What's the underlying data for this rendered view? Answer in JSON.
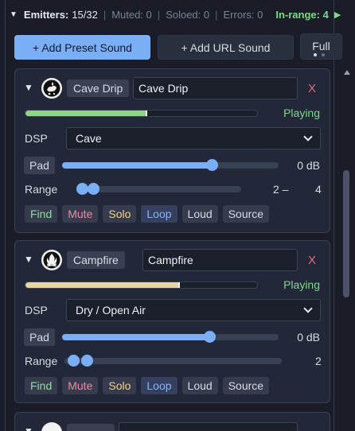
{
  "header": {
    "title": "Emitters:",
    "count": "15/32",
    "muted": "Muted: 0",
    "soloed": "Soloed: 0",
    "errors": "Errors: 0",
    "in_range": "In-range: 4"
  },
  "toolbar": {
    "add_preset": "+ Add Preset Sound",
    "add_url": "+ Add URL Sound",
    "full": "Full"
  },
  "emitters": [
    {
      "tag": "Cave Drip",
      "name": "Cave Drip",
      "progress": 0.52,
      "progress_color": "#8fd48a",
      "status": "Playing",
      "dsp_label": "DSP",
      "dsp": "Cave",
      "pad_label": "Pad",
      "gain_pct": 0.69,
      "gain": "0 dB",
      "range_label": "Range",
      "range_min": "2",
      "range_max": "4",
      "range_min_text": "2 –",
      "range_max_text": "4",
      "chips": [
        "Find",
        "Mute",
        "Solo",
        "Loop",
        "Loud",
        "Source"
      ],
      "close": "X",
      "icon": "water-drip-icon"
    },
    {
      "tag": "Campfire",
      "name": "Campfire",
      "progress": 0.66,
      "progress_color": "#e8d4a8",
      "status": "Playing",
      "dsp_label": "DSP",
      "dsp": "Dry / Open Air",
      "pad_label": "Pad",
      "gain_pct": 0.68,
      "gain": "0 dB",
      "range_label": "Range",
      "range_min": "",
      "range_max": "2",
      "range_min_text": "",
      "range_max_text": "2",
      "chips": [
        "Find",
        "Mute",
        "Solo",
        "Loop",
        "Loud",
        "Source"
      ],
      "close": "X",
      "icon": "fire-icon"
    }
  ],
  "colors": {
    "accent": "#7aaef5",
    "playing": "#7fd98a",
    "close": "#e06d86"
  }
}
